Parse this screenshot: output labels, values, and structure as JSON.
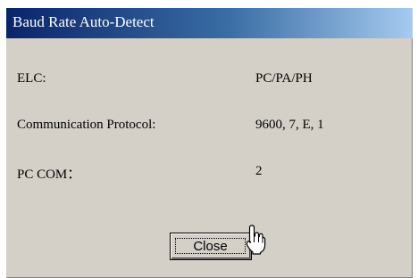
{
  "window": {
    "title": "Baud Rate Auto-Detect"
  },
  "fields": [
    {
      "label": "ELC:",
      "value": "PC/PA/PH"
    },
    {
      "label": "Communication Protocol:",
      "value": "9600, 7, E, 1"
    },
    {
      "label": "PC COM：",
      "value": "2"
    }
  ],
  "buttons": {
    "close_label": "Close"
  },
  "icons": {
    "cursor": "hand-pointer-icon"
  },
  "colors": {
    "title_bar_start": "#0a246a",
    "title_bar_end": "#a6caf0",
    "dialog_bg": "#d4d0c8"
  }
}
